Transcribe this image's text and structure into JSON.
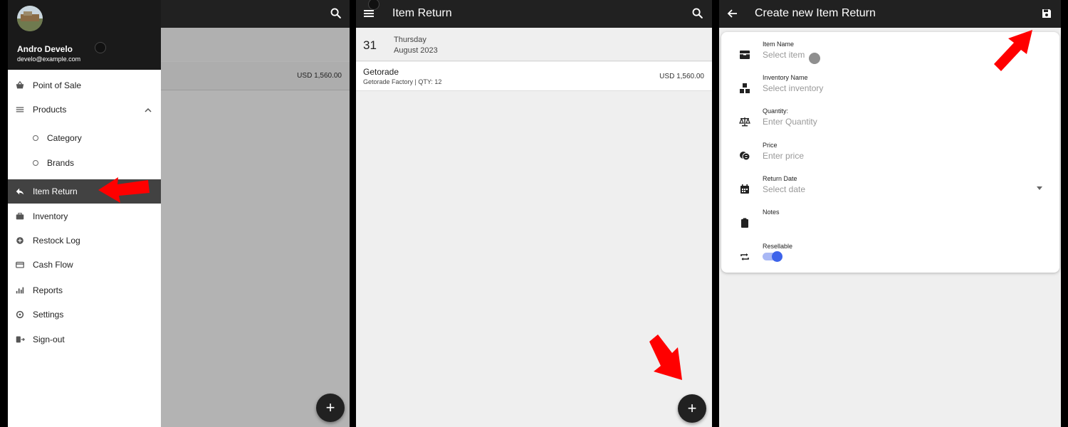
{
  "colors": {
    "appbar": "#212121",
    "active_nav": "#424242",
    "arrow": "#ff0000",
    "switch_on": "#3d63ea"
  },
  "panel1": {
    "user": {
      "name": "Andro Develo",
      "email": "develo@example.com"
    },
    "amount": "USD 1,560.00",
    "nav": {
      "point_of_sale": {
        "label": "Point of Sale",
        "icon": "basket-icon"
      },
      "products": {
        "label": "Products",
        "icon": "list-icon"
      },
      "category": {
        "label": "Category"
      },
      "brands": {
        "label": "Brands"
      },
      "item_return": {
        "label": "Item Return",
        "icon": "reply-icon"
      },
      "inventory": {
        "label": "Inventory",
        "icon": "briefcase-icon"
      },
      "restock_log": {
        "label": "Restock Log",
        "icon": "plus-circle-icon"
      },
      "cash_flow": {
        "label": "Cash Flow",
        "icon": "card-icon"
      },
      "reports": {
        "label": "Reports",
        "icon": "bar-chart-icon"
      },
      "settings": {
        "label": "Settings",
        "icon": "gear-icon"
      },
      "sign_out": {
        "label": "Sign-out",
        "icon": "sign-out-icon"
      }
    },
    "fab_label": "+"
  },
  "panel2": {
    "title": "Item Return",
    "date": {
      "day": "31",
      "weekday": "Thursday",
      "month_year": "August 2023"
    },
    "item": {
      "name": "Getorade",
      "details": "Getorade Factory | QTY: 12",
      "amount": "USD 1,560.00"
    },
    "fab_label": "+"
  },
  "panel3": {
    "title": "Create new Item Return",
    "fields": {
      "item_name": {
        "label": "Item Name",
        "placeholder": "Select item",
        "icon": "box-icon"
      },
      "inventory_name": {
        "label": "Inventory Name",
        "placeholder": "Select inventory",
        "icon": "boxes-icon"
      },
      "quantity": {
        "label": "Quantity:",
        "placeholder": "Enter Quantity",
        "icon": "scale-icon"
      },
      "price": {
        "label": "Price",
        "placeholder": "Enter price",
        "icon": "price-icon"
      },
      "return_date": {
        "label": "Return Date",
        "placeholder": "Select date",
        "icon": "calendar-icon"
      },
      "notes": {
        "label": "Notes",
        "icon": "clipboard-icon"
      },
      "resellable": {
        "label": "Resellable",
        "icon": "repeat-icon",
        "value": true
      }
    }
  }
}
